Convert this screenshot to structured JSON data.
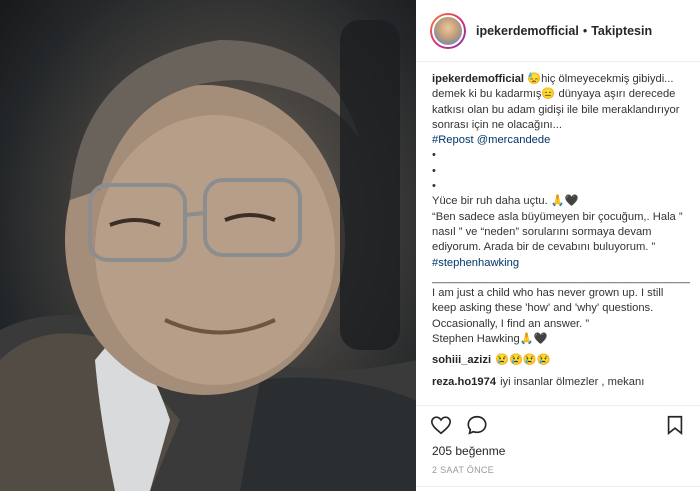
{
  "post": {
    "image_alt": "Portrait of Stephen Hawking"
  },
  "header": {
    "username": "ipekerdemofficial",
    "separator": "•",
    "follow_label": "Takiptesin"
  },
  "caption": {
    "username": "ipekerdemofficial",
    "text_1": " 😓hiç ölmeyecekmiş gibiydi... demek ki bu kadarmış😑 dünyaya aşırı derecede katkısı olan bu adam gidişi ile bile meraklandırıyor sonrası için ne olacağını...",
    "repost": "#Repost @mercandede",
    "dots": "•\n•\n•",
    "text_2": "Yüce bir ruh daha uçtu. 🙏🖤\n“Ben sadece asla büyümeyen bir çocuğum,. Hala ” nasıl ” ve “neden” sorularını sormaya devam ediyorum. Arada bir de cevabını buluyorum. ” ",
    "hashtag": "#stephenhawking",
    "divider": "______________________________________________",
    "text_3": "I am just a child who has never grown up. I still keep asking these 'how' and 'why' questions. Occasionally, I find an answer. ”\nStephen Hawking🙏🖤"
  },
  "comments": [
    {
      "user": "sohiii_azizi",
      "text": "😢😢😢😢"
    },
    {
      "user": "reza.ho1974",
      "text": "iyi insanlar ölmezler , mekanı"
    }
  ],
  "actions": {
    "likes": "205 beğenme",
    "time": "2 SAAT ÖNCE"
  },
  "colors": {
    "hashtag": "#003569",
    "border": "#efefef"
  },
  "icons": [
    "heart-icon",
    "comment-icon",
    "bookmark-icon"
  ]
}
